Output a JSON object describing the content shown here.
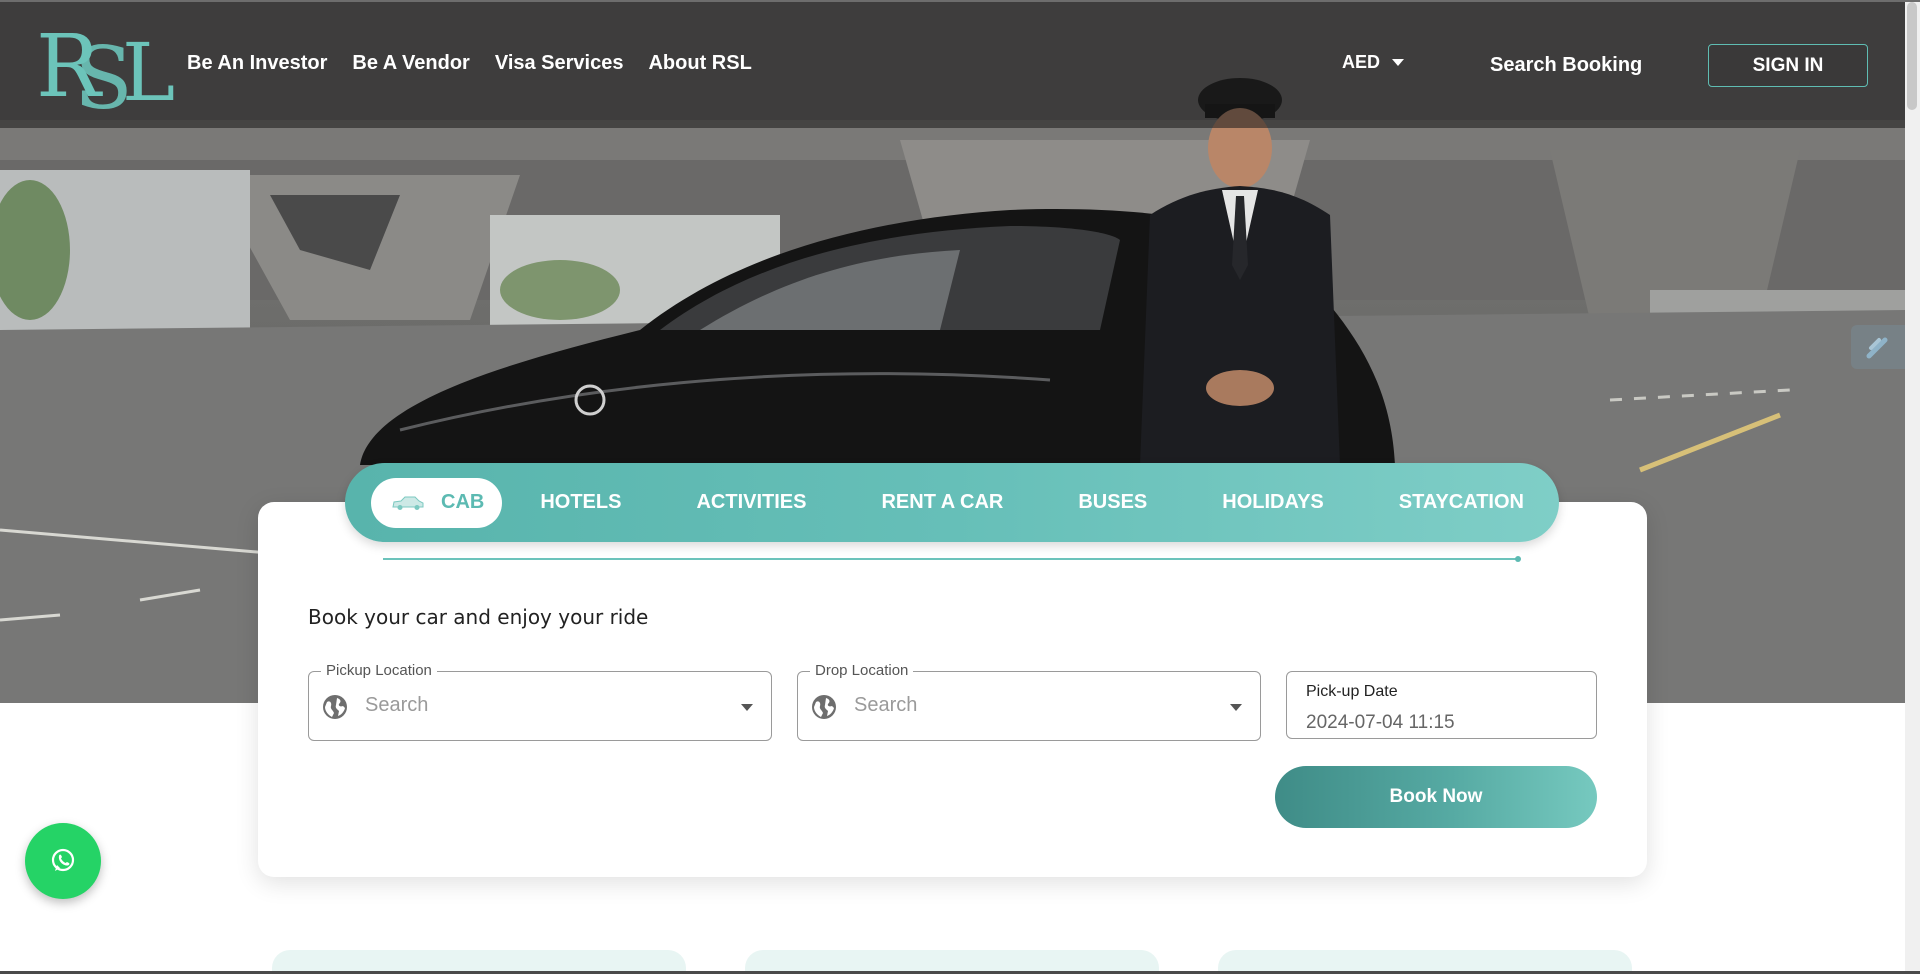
{
  "header": {
    "logo_text": "RSL",
    "nav": [
      {
        "label": "Be An Investor"
      },
      {
        "label": "Be A Vendor"
      },
      {
        "label": "Visa Services"
      },
      {
        "label": "About RSL"
      }
    ],
    "currency": "AED",
    "search_booking": "Search Booking",
    "sign_in": "SIGN IN"
  },
  "tabs": [
    {
      "label": "CAB",
      "icon": "car-icon",
      "active": true
    },
    {
      "label": "HOTELS"
    },
    {
      "label": "ACTIVITIES"
    },
    {
      "label": "RENT A CAR"
    },
    {
      "label": "BUSES"
    },
    {
      "label": "HOLIDAYS"
    },
    {
      "label": "STAYCATION"
    }
  ],
  "booking": {
    "headline": "Book your car and enjoy your ride",
    "pickup": {
      "legend": "Pickup Location",
      "placeholder": "Search",
      "icon": "globe-icon"
    },
    "drop": {
      "legend": "Drop Location",
      "placeholder": "Search",
      "icon": "globe-icon"
    },
    "date": {
      "label": "Pick-up Date",
      "value": "2024-07-04 11:15"
    },
    "book_now": "Book Now"
  },
  "floating": {
    "whatsapp_icon": "whatsapp-icon"
  },
  "colors": {
    "accent": "#5cbab2",
    "accent_dark": "#3f8c87",
    "whatsapp": "#25d366"
  }
}
